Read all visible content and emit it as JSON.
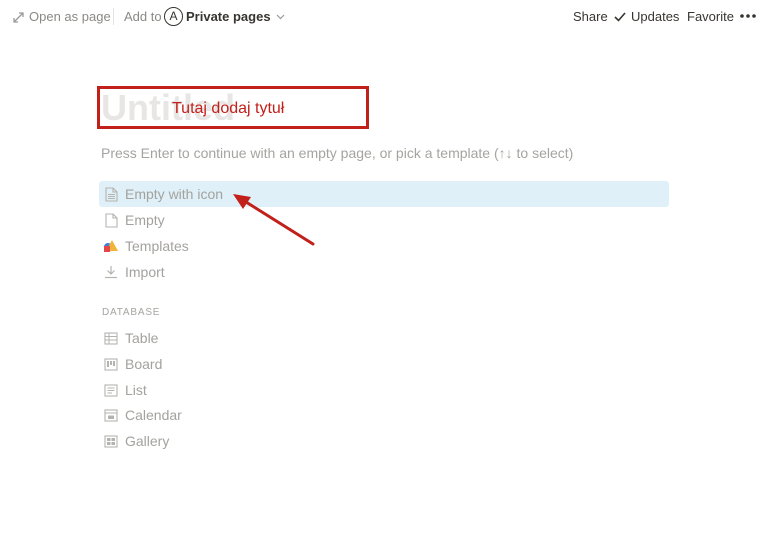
{
  "topbar": {
    "open_as_page": "Open as page",
    "add_to": "Add to",
    "avatar_letter": "A",
    "workspace": "Private pages",
    "share": "Share",
    "updates": "Updates",
    "favorite": "Favorite"
  },
  "page": {
    "title_placeholder": "Untitled",
    "hint": "Press Enter to continue with an empty page, or pick a template (↑↓ to select)"
  },
  "annotation": {
    "text": "Tutaj dodaj tytuł",
    "color": "#c1201b"
  },
  "options": [
    {
      "label": "Empty with icon",
      "icon": "page-text-icon",
      "selected": true
    },
    {
      "label": "Empty",
      "icon": "page-icon",
      "selected": false
    },
    {
      "label": "Templates",
      "icon": "templates-shapes-icon",
      "selected": false
    },
    {
      "label": "Import",
      "icon": "download-icon",
      "selected": false
    }
  ],
  "database": {
    "section_label": "DATABASE",
    "items": [
      {
        "label": "Table",
        "icon": "table-icon"
      },
      {
        "label": "Board",
        "icon": "board-icon"
      },
      {
        "label": "List",
        "icon": "list-icon"
      },
      {
        "label": "Calendar",
        "icon": "calendar-icon"
      },
      {
        "label": "Gallery",
        "icon": "gallery-icon"
      }
    ]
  },
  "colors": {
    "selected_row": "#dff0f8",
    "muted_text": "#a3a29e",
    "icon_gray": "#b4b3af"
  }
}
